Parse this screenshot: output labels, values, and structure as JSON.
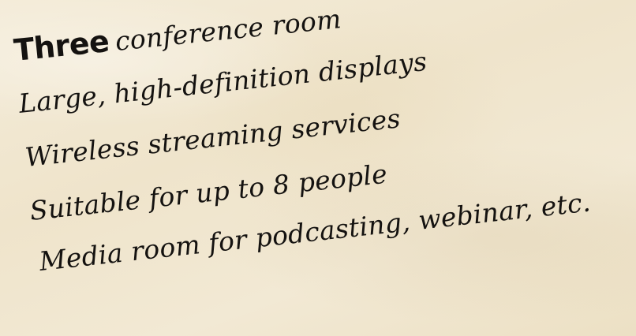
{
  "lines": [
    {
      "emphasis": "Three",
      "text": "conference room"
    },
    {
      "text": "Large, high-definition displays"
    },
    {
      "text": "Wireless streaming services"
    },
    {
      "text": "Suitable for up to 8 people"
    },
    {
      "text": "Media room for podcasting, webinar, etc."
    }
  ]
}
